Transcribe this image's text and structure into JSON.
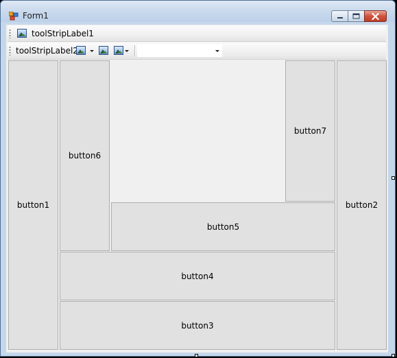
{
  "window": {
    "title": "Form1",
    "icon": "form-app-icon",
    "caption_buttons": [
      "minimize-icon",
      "maximize-icon",
      "close-icon"
    ]
  },
  "toolstrip1": {
    "label": "toolStripLabel1",
    "icon": "image-icon"
  },
  "toolstrip2": {
    "label": "toolStripLabel2",
    "items": [
      "image-dropdown-button",
      "image-button",
      "image-dropdown-button",
      "combobox"
    ],
    "combo_value": ""
  },
  "buttons": {
    "button1": "button1",
    "button2": "button2",
    "button3": "button3",
    "button4": "button4",
    "button5": "button5",
    "button6": "button6",
    "button7": "button7"
  },
  "colors": {
    "client_bg": "#f0f0f0",
    "button_bg": "#e1e1e1",
    "button_border": "#adadad",
    "close_button": "#c13d27",
    "title_bar": "#cbdbed"
  }
}
